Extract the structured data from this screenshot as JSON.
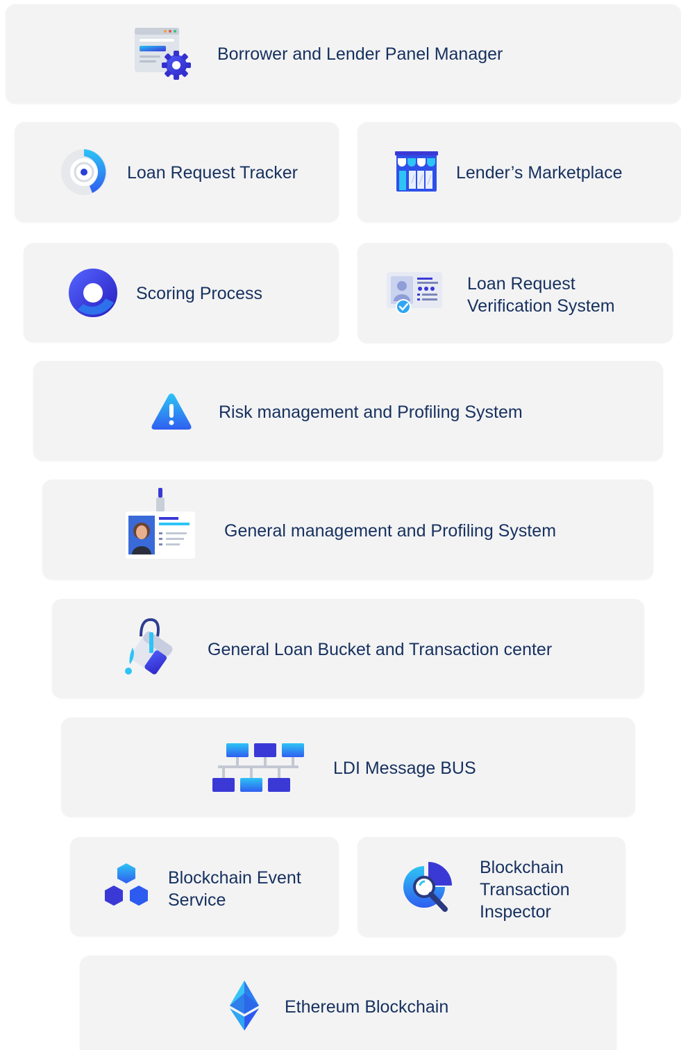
{
  "cards": {
    "panel_manager": "Borrower and Lender Panel Manager",
    "loan_request_tracker": "Loan Request Tracker",
    "lenders_marketplace": "Lender’s Marketplace",
    "scoring_process": "Scoring Process",
    "verification_line1": "Loan Request",
    "verification_line2": "Verification System",
    "risk_management": "Risk management and Profiling System",
    "general_management": "General management and Profiling System",
    "loan_bucket": "General Loan Bucket and Transaction center",
    "message_bus": "LDI Message BUS",
    "event_service_line1": "Blockchain Event",
    "event_service_line2": "Service",
    "inspector_line1": "Blockchain",
    "inspector_line2": "Transaction",
    "inspector_line3": "Inspector",
    "ethereum": "Ethereum Blockchain"
  },
  "icons": {
    "panel_manager": "browser-gear-icon",
    "loan_request_tracker": "target-tracker-icon",
    "lenders_marketplace": "storefront-icon",
    "scoring_process": "ring-score-icon",
    "verification": "id-card-check-icon",
    "risk_management": "warning-triangle-icon",
    "general_management": "id-badge-icon",
    "loan_bucket": "paint-bucket-icon",
    "message_bus": "network-bus-icon",
    "event_service": "hexagon-cluster-icon",
    "inspector": "magnifier-chart-icon",
    "ethereum": "ethereum-icon"
  },
  "colors": {
    "text": "#16305e",
    "card_bg": "#f3f3f4",
    "accent_blue": "#2d5bf0",
    "accent_cyan": "#29b3f0",
    "accent_indigo": "#3a39d6"
  }
}
